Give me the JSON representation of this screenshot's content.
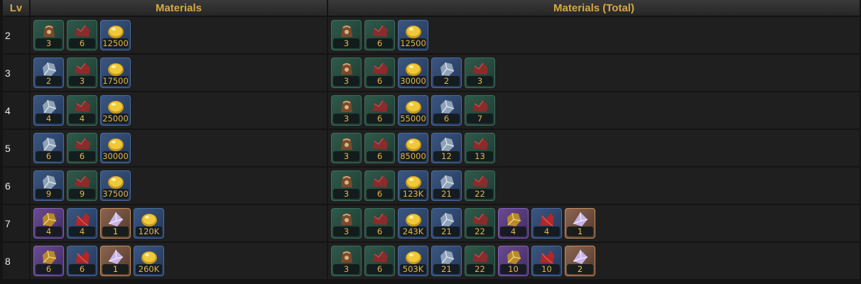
{
  "header": {
    "lv": "Lv",
    "materials": "Materials",
    "materials_total": "Materials (Total)"
  },
  "colors": {
    "header_text": "#d8a840",
    "qty_text": "#e6b44a"
  },
  "rows": [
    {
      "lv": "2",
      "materials": [
        {
          "icon": "leather-pouch-icon",
          "bg": "green",
          "qty": "3"
        },
        {
          "icon": "red-cloth-icon",
          "bg": "green",
          "qty": "6"
        },
        {
          "icon": "gold-coin-icon",
          "bg": "blue",
          "qty": "12500"
        }
      ],
      "total": [
        {
          "icon": "leather-pouch-icon",
          "bg": "green",
          "qty": "3"
        },
        {
          "icon": "red-cloth-icon",
          "bg": "green",
          "qty": "6"
        },
        {
          "icon": "gold-coin-icon",
          "bg": "blue",
          "qty": "12500"
        }
      ]
    },
    {
      "lv": "3",
      "materials": [
        {
          "icon": "silver-ore-icon",
          "bg": "blue",
          "qty": "2"
        },
        {
          "icon": "red-cloth-icon",
          "bg": "green",
          "qty": "3"
        },
        {
          "icon": "gold-coin-icon",
          "bg": "blue",
          "qty": "17500"
        }
      ],
      "total": [
        {
          "icon": "leather-pouch-icon",
          "bg": "green",
          "qty": "3"
        },
        {
          "icon": "red-cloth-icon",
          "bg": "green",
          "qty": "6"
        },
        {
          "icon": "gold-coin-icon",
          "bg": "blue",
          "qty": "30000"
        },
        {
          "icon": "silver-ore-icon",
          "bg": "blue",
          "qty": "2"
        },
        {
          "icon": "red-cloth-icon",
          "bg": "green",
          "qty": "3"
        }
      ]
    },
    {
      "lv": "4",
      "materials": [
        {
          "icon": "silver-ore-icon",
          "bg": "blue",
          "qty": "4"
        },
        {
          "icon": "red-cloth-icon",
          "bg": "green",
          "qty": "4"
        },
        {
          "icon": "gold-coin-icon",
          "bg": "blue",
          "qty": "25000"
        }
      ],
      "total": [
        {
          "icon": "leather-pouch-icon",
          "bg": "green",
          "qty": "3"
        },
        {
          "icon": "red-cloth-icon",
          "bg": "green",
          "qty": "6"
        },
        {
          "icon": "gold-coin-icon",
          "bg": "blue",
          "qty": "55000"
        },
        {
          "icon": "silver-ore-icon",
          "bg": "blue",
          "qty": "6"
        },
        {
          "icon": "red-cloth-icon",
          "bg": "green",
          "qty": "7"
        }
      ]
    },
    {
      "lv": "5",
      "materials": [
        {
          "icon": "silver-ore-icon",
          "bg": "blue",
          "qty": "6"
        },
        {
          "icon": "red-cloth-icon",
          "bg": "green",
          "qty": "6"
        },
        {
          "icon": "gold-coin-icon",
          "bg": "blue",
          "qty": "30000"
        }
      ],
      "total": [
        {
          "icon": "leather-pouch-icon",
          "bg": "green",
          "qty": "3"
        },
        {
          "icon": "red-cloth-icon",
          "bg": "green",
          "qty": "6"
        },
        {
          "icon": "gold-coin-icon",
          "bg": "blue",
          "qty": "85000"
        },
        {
          "icon": "silver-ore-icon",
          "bg": "blue",
          "qty": "12"
        },
        {
          "icon": "red-cloth-icon",
          "bg": "green",
          "qty": "13"
        }
      ]
    },
    {
      "lv": "6",
      "materials": [
        {
          "icon": "silver-ore-icon",
          "bg": "blue",
          "qty": "9"
        },
        {
          "icon": "red-cloth-icon",
          "bg": "green",
          "qty": "9"
        },
        {
          "icon": "gold-coin-icon",
          "bg": "blue",
          "qty": "37500"
        }
      ],
      "total": [
        {
          "icon": "leather-pouch-icon",
          "bg": "green",
          "qty": "3"
        },
        {
          "icon": "red-cloth-icon",
          "bg": "green",
          "qty": "6"
        },
        {
          "icon": "gold-coin-icon",
          "bg": "blue",
          "qty": "123K"
        },
        {
          "icon": "silver-ore-icon",
          "bg": "blue",
          "qty": "21"
        },
        {
          "icon": "red-cloth-icon",
          "bg": "green",
          "qty": "22"
        }
      ]
    },
    {
      "lv": "7",
      "materials": [
        {
          "icon": "gold-ore-icon",
          "bg": "purple",
          "qty": "4"
        },
        {
          "icon": "red-silk-icon",
          "bg": "blue",
          "qty": "4"
        },
        {
          "icon": "crystal-shard-icon",
          "bg": "orange",
          "qty": "1"
        },
        {
          "icon": "gold-coin-icon",
          "bg": "blue",
          "qty": "120K"
        }
      ],
      "total": [
        {
          "icon": "leather-pouch-icon",
          "bg": "green",
          "qty": "3"
        },
        {
          "icon": "red-cloth-icon",
          "bg": "green",
          "qty": "6"
        },
        {
          "icon": "gold-coin-icon",
          "bg": "blue",
          "qty": "243K"
        },
        {
          "icon": "silver-ore-icon",
          "bg": "blue",
          "qty": "21"
        },
        {
          "icon": "red-cloth-icon",
          "bg": "green",
          "qty": "22"
        },
        {
          "icon": "gold-ore-icon",
          "bg": "purple",
          "qty": "4"
        },
        {
          "icon": "red-silk-icon",
          "bg": "blue",
          "qty": "4"
        },
        {
          "icon": "crystal-shard-icon",
          "bg": "orange",
          "qty": "1"
        }
      ]
    },
    {
      "lv": "8",
      "materials": [
        {
          "icon": "gold-ore-icon",
          "bg": "purple",
          "qty": "6"
        },
        {
          "icon": "red-silk-icon",
          "bg": "blue",
          "qty": "6"
        },
        {
          "icon": "crystal-shard-icon",
          "bg": "orange",
          "qty": "1"
        },
        {
          "icon": "gold-coin-icon",
          "bg": "blue",
          "qty": "260K"
        }
      ],
      "total": [
        {
          "icon": "leather-pouch-icon",
          "bg": "green",
          "qty": "3"
        },
        {
          "icon": "red-cloth-icon",
          "bg": "green",
          "qty": "6"
        },
        {
          "icon": "gold-coin-icon",
          "bg": "blue",
          "qty": "503K"
        },
        {
          "icon": "silver-ore-icon",
          "bg": "blue",
          "qty": "21"
        },
        {
          "icon": "red-cloth-icon",
          "bg": "green",
          "qty": "22"
        },
        {
          "icon": "gold-ore-icon",
          "bg": "purple",
          "qty": "10"
        },
        {
          "icon": "red-silk-icon",
          "bg": "blue",
          "qty": "10"
        },
        {
          "icon": "crystal-shard-icon",
          "bg": "orange",
          "qty": "2"
        }
      ]
    }
  ]
}
